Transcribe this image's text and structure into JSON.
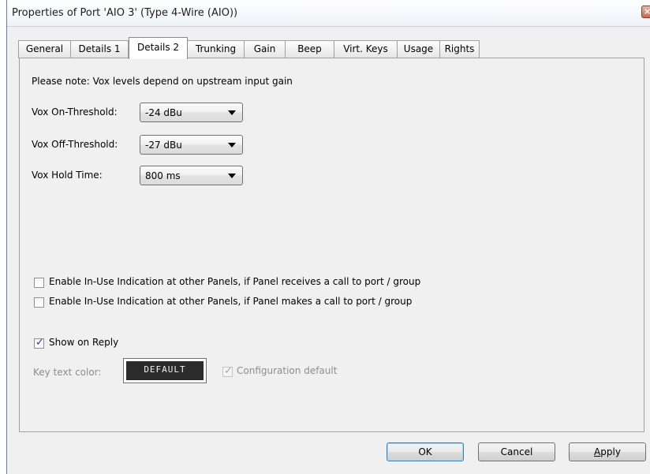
{
  "window": {
    "title": "Properties of Port 'AIO 3' (Type 4-Wire (AIO))",
    "close_glyph": "×"
  },
  "tabs": [
    {
      "label": "General"
    },
    {
      "label": "Details 1"
    },
    {
      "label": "Details 2",
      "active": true
    },
    {
      "label": "Trunking"
    },
    {
      "label": "Gain"
    },
    {
      "label": "Beep"
    },
    {
      "label": "Virt. Keys"
    },
    {
      "label": "Usage"
    },
    {
      "label": "Rights"
    }
  ],
  "details2": {
    "note": "Please note: Vox levels depend on upstream input gain",
    "vox_on": {
      "label": "Vox On-Threshold:",
      "value": "-24 dBu"
    },
    "vox_off": {
      "label": "Vox Off-Threshold:",
      "value": "-27 dBu"
    },
    "vox_hold": {
      "label": "Vox Hold Time:",
      "value": "800 ms"
    },
    "inuse_receives": {
      "label": "Enable In-Use Indication at other Panels, if Panel receives a call to port / group",
      "checked": false
    },
    "inuse_makes": {
      "label": "Enable In-Use Indication at other Panels, if Panel makes a call to port / group",
      "checked": false
    },
    "show_on_reply": {
      "label": "Show on Reply",
      "checked": true
    },
    "key_text_color_label": "Key text color:",
    "key_text_color_button": "DEFAULT",
    "config_default": {
      "label": "Configuration default",
      "checked": true,
      "enabled": false
    },
    "check_glyph": "✓"
  },
  "buttons": {
    "ok": "OK",
    "cancel": "Cancel",
    "apply": "Apply"
  }
}
